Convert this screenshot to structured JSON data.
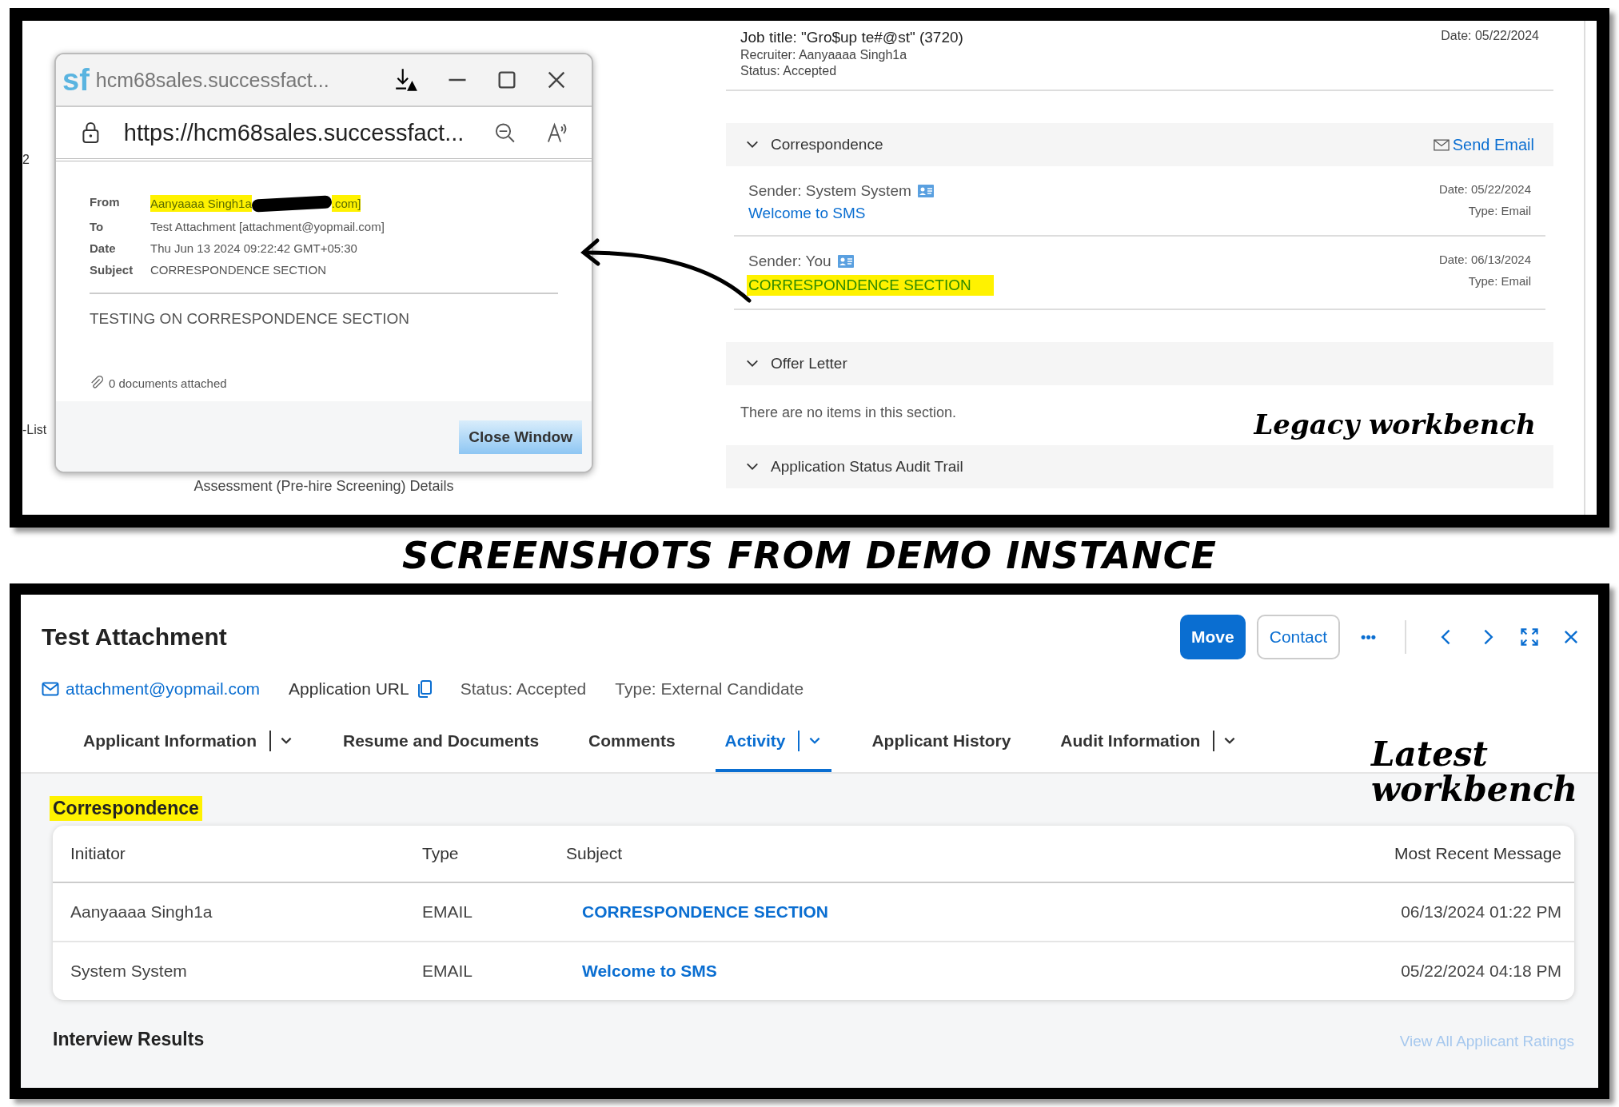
{
  "legacy": {
    "background_fragments": [
      "2",
      "-List"
    ],
    "footer_fragment": "Assessment (Pre-hire Screening) Details",
    "popup": {
      "logo": "sf",
      "tab_title": "hcm68sales.successfact...",
      "url": "https://hcm68sales.successfact...",
      "fields": [
        {
          "label": "From",
          "value": "Aanyaaaa Singh1a",
          "value_end": ".com]",
          "redacted": true,
          "highlighted": true
        },
        {
          "label": "To",
          "value": "Test Attachment [attachment@yopmail.com]",
          "highlighted": false
        },
        {
          "label": "Date",
          "value": "Thu Jun 13 2024 09:22:42 GMT+05:30",
          "highlighted": false
        },
        {
          "label": "Subject",
          "value": "CORRESPONDENCE SECTION",
          "highlighted": false
        }
      ],
      "body": "TESTING ON CORRESPONDENCE SECTION",
      "attachments": "0 documents attached",
      "close_button": "Close Window"
    },
    "job": {
      "title": "Job title: \"Gro$up te#@st\" (3720)",
      "recruiter_label": "Recruiter:",
      "recruiter": "Aanyaaaa Singh1a",
      "status_label": "Status:",
      "status": "Accepted",
      "date": "Date: 05/22/2024"
    },
    "sections": [
      {
        "title": "Correspondence",
        "action": "Send Email",
        "messages": [
          {
            "sender": "Sender: System System",
            "subject": "Welcome to SMS",
            "date": "Date: 05/22/2024",
            "type": "Type: Email",
            "highlighted": false
          },
          {
            "sender": "Sender: You",
            "subject": "CORRESPONDENCE SECTION",
            "date": "Date: 06/13/2024",
            "type": "Type: Email",
            "highlighted": true
          }
        ]
      },
      {
        "title": "Offer Letter",
        "empty_text": "There are no items in this section."
      },
      {
        "title": "Application Status Audit Trail"
      }
    ]
  },
  "annotations": {
    "overlay_title": "SCREENSHOTS FROM DEMO INSTANCE",
    "legacy_label": "Legacy workbench",
    "latest_label": "Latest workbench"
  },
  "latest": {
    "title": "Test Attachment",
    "email": "attachment@yopmail.com",
    "application_url": "Application URL",
    "status": "Status: Accepted",
    "type": "Type: External Candidate",
    "buttons": {
      "move": "Move",
      "contact": "Contact",
      "more": "•••"
    },
    "tabs": [
      {
        "label": "Applicant Information",
        "selected": false,
        "has_menu": true
      },
      {
        "label": "Resume and Documents",
        "selected": false,
        "has_menu": false
      },
      {
        "label": "Comments",
        "selected": false,
        "has_menu": false
      },
      {
        "label": "Activity",
        "selected": true,
        "has_menu": true
      },
      {
        "label": "Applicant History",
        "selected": false,
        "has_menu": false
      },
      {
        "label": "Audit Information",
        "selected": false,
        "has_menu": true
      }
    ],
    "section_title": "Correspondence",
    "section_highlighted": true,
    "table": {
      "columns": [
        "Initiator",
        "Type",
        "Subject",
        "Most Recent Message"
      ],
      "rows": [
        [
          "Aanyaaaa Singh1a",
          "EMAIL",
          "CORRESPONDENCE SECTION",
          "06/13/2024 01:22 PM"
        ],
        [
          "System System",
          "EMAIL",
          "Welcome to SMS",
          "05/22/2024 04:18 PM"
        ]
      ]
    },
    "next_section": "Interview Results",
    "ratings_link": "View All Applicant Ratings"
  }
}
